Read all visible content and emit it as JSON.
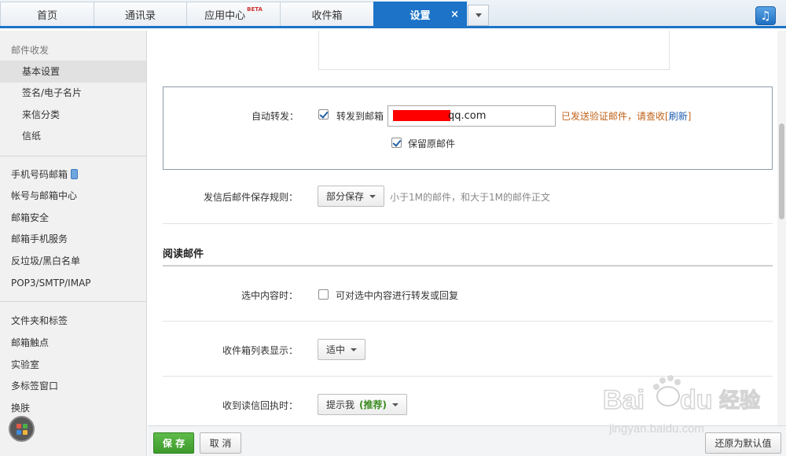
{
  "tabs": [
    {
      "label": "首页"
    },
    {
      "label": "通讯录"
    },
    {
      "label": "应用中心",
      "badge": "BETA"
    },
    {
      "label": "收件箱"
    },
    {
      "label": "设置",
      "active": true,
      "close": "×"
    }
  ],
  "sidebar": {
    "group_title": "邮件收发",
    "sub_items": [
      {
        "label": "基本设置",
        "selected": true
      },
      {
        "label": "签名/电子名片"
      },
      {
        "label": "来信分类"
      },
      {
        "label": "信纸"
      }
    ],
    "items_a": [
      {
        "label": "手机号码邮箱"
      },
      {
        "label": "帐号与邮箱中心"
      },
      {
        "label": "邮箱安全"
      },
      {
        "label": "邮箱手机服务"
      },
      {
        "label": "反垃圾/黑白名单"
      },
      {
        "label": "POP3/SMTP/IMAP"
      }
    ],
    "items_b": [
      {
        "label": "文件夹和标签"
      },
      {
        "label": "邮箱触点"
      },
      {
        "label": "实验室"
      },
      {
        "label": "多标签窗口"
      },
      {
        "label": "换肤"
      }
    ]
  },
  "forwarding": {
    "label": "自动转发：",
    "forward_checkbox_label": "转发到邮箱",
    "forward_checked": true,
    "email_value": "qq.com",
    "email_redacted": true,
    "notice_text": "已发送验证邮件，请查收[",
    "refresh_link": "刷新",
    "notice_close": "]",
    "keep_original_label": "保留原邮件",
    "keep_original_checked": true
  },
  "save_rule": {
    "label": "发信后邮件保存规则：",
    "dropdown_value": "部分保存",
    "hint": "小于1M的邮件，和大于1M的邮件正文"
  },
  "reading_section": {
    "title": "阅读邮件",
    "select_content": {
      "label": "选中内容时：",
      "checkbox_label": "可对选中内容进行转发或回复",
      "checked": false
    },
    "inbox_list": {
      "label": "收件箱列表显示：",
      "dropdown_value": "适中"
    },
    "read_receipt": {
      "label": "收到读信回执时：",
      "dropdown_value": "提示我",
      "recommended": "(推荐)"
    }
  },
  "bottom": {
    "save": "保 存",
    "cancel": "取 消",
    "restore": "还原为默认值"
  },
  "watermark": {
    "brand": "Baidu 经验",
    "url": "jingyan.baidu.com"
  },
  "colors": {
    "accent": "#1c73c8",
    "save_green": "#3c9a2b",
    "notice_orange": "#c0621a",
    "link_blue": "#1f5fb0",
    "redaction": "#ff0000"
  },
  "icons": {
    "music": "music-note-icon",
    "app_grid": "app-grid-icon",
    "phone": "phone-icon"
  }
}
